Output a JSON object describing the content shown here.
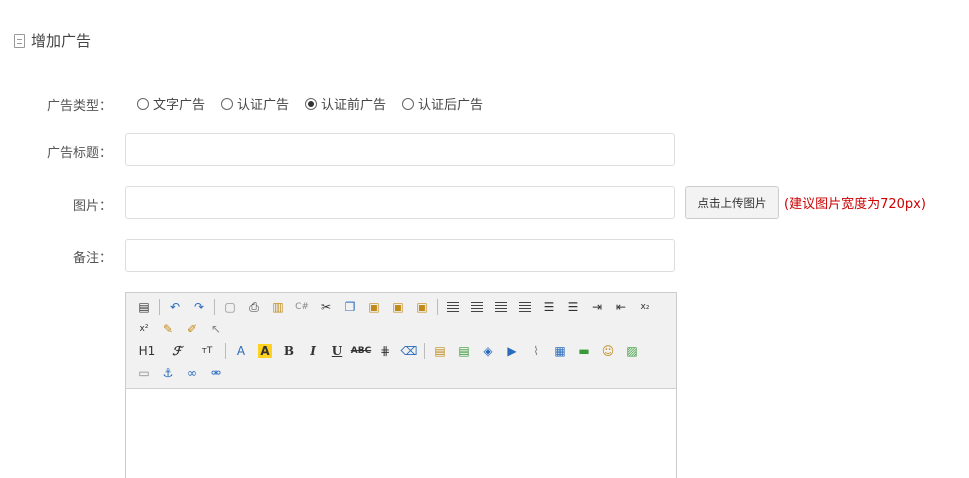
{
  "page": {
    "title": "增加广告"
  },
  "form": {
    "type_label": "广告类型：",
    "title_label": "广告标题：",
    "image_label": "图片：",
    "note_label": "备注：",
    "ad_types": [
      {
        "label": "文字广告",
        "checked": false
      },
      {
        "label": "认证广告",
        "checked": false
      },
      {
        "label": "认证前广告",
        "checked": true
      },
      {
        "label": "认证后广告",
        "checked": false
      }
    ],
    "title_value": "",
    "image_value": "",
    "note_value": "",
    "upload_button": "点击上传图片",
    "upload_hint": "(建议图片宽度为720px)",
    "upload_hint_color": "#cc0000"
  },
  "editor": {
    "toolbar": {
      "h1": "H1",
      "font_family": "ℱ",
      "font_size": "тT",
      "font_color": "A",
      "highlight": "A",
      "bold": "B",
      "italic": "I",
      "underline": "U",
      "strike": "ABC",
      "superscript": "x²",
      "subscript": "x₂"
    }
  }
}
